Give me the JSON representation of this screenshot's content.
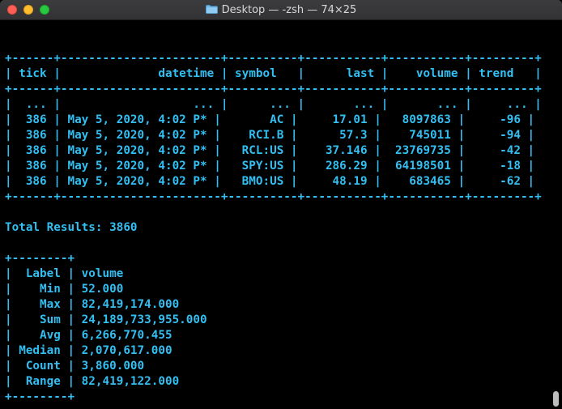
{
  "window": {
    "title": "Desktop — -zsh — 74×25",
    "colors": {
      "text": "#33bff2",
      "background": "#000000"
    }
  },
  "terminal": {
    "lines": [
      "",
      "+------+-----------------------+----------+-----------+-----------+---------+",
      "| tick |              datetime | symbol   |      last |    volume | trend   |",
      "+------+-----------------------+----------+-----------+-----------+---------+",
      "|  ... |                   ... |      ... |       ... |       ... |     ... |",
      "|  386 | May 5, 2020, 4:02 P* |       AC |     17.01 |   8097863 |     -96 |",
      "|  386 | May 5, 2020, 4:02 P* |    RCI.B |      57.3 |    745011 |     -94 |",
      "|  386 | May 5, 2020, 4:02 P* |   RCL:US |    37.146 |  23769735 |     -42 |",
      "|  386 | May 5, 2020, 4:02 P* |   SPY:US |    286.29 |  64198501 |     -18 |",
      "|  386 | May 5, 2020, 4:02 P* |   BMO:US |     48.19 |    683465 |     -62 |",
      "+------+-----------------------+----------+-----------+-----------+---------+",
      "",
      "Total Results: 3860",
      "",
      "+--------+",
      "|  Label | volume",
      "|    Min | 52.000",
      "|    Max | 82,419,174.000",
      "|    Sum | 24,189,733,955.000",
      "|    Avg | 6,266,770.455",
      "| Median | 2,070,617.000",
      "|  Count | 3,860.000",
      "|  Range | 82,419,122.000",
      "+--------+"
    ]
  }
}
